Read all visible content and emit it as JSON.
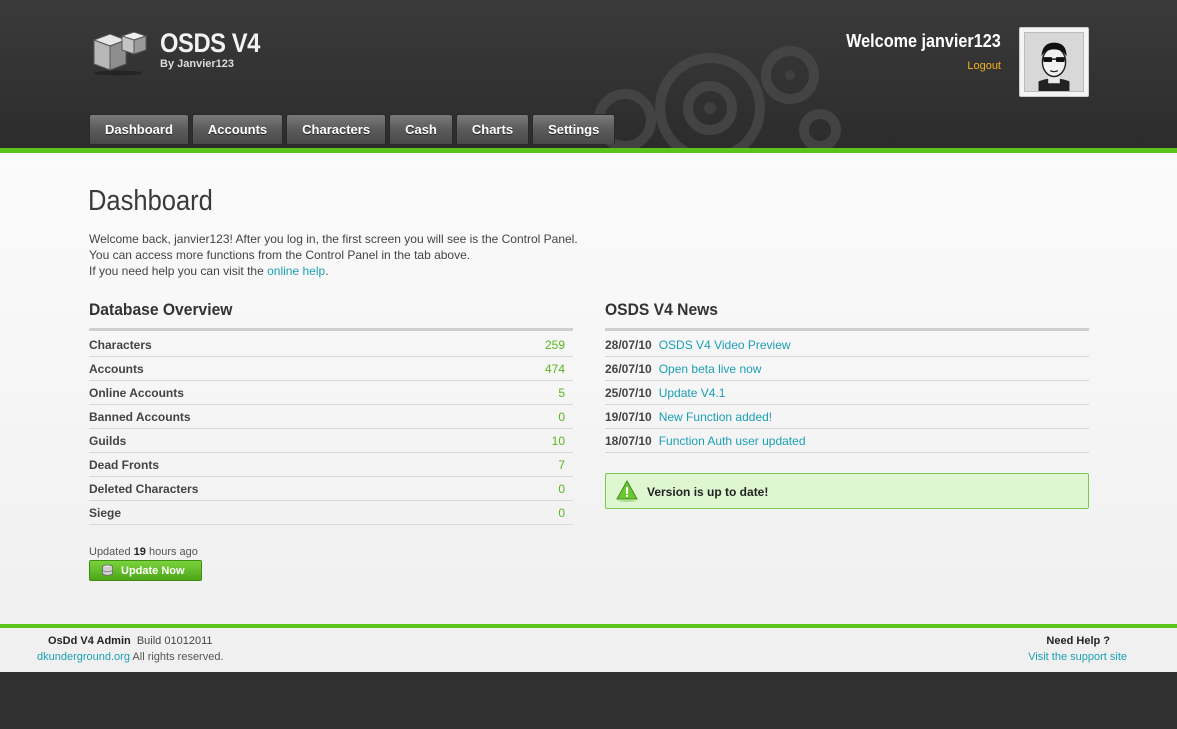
{
  "header": {
    "app_title": "OSDS V4",
    "app_subtitle": "By Janvier123",
    "welcome": "Welcome janvier123",
    "logout": "Logout",
    "nav": [
      {
        "label": "Dashboard"
      },
      {
        "label": "Accounts"
      },
      {
        "label": "Characters"
      },
      {
        "label": "Cash"
      },
      {
        "label": "Charts"
      },
      {
        "label": "Settings"
      }
    ]
  },
  "main": {
    "title": "Dashboard",
    "intro_line1": "Welcome back, janvier123! After you log in, the first screen you will see is the Control Panel.",
    "intro_line2": "You can access more functions from the Control Panel in the tab above.",
    "intro_line3_prefix": "If you need help you can visit the ",
    "intro_link": "online help",
    "intro_line3_suffix": "."
  },
  "overview": {
    "title": "Database Overview",
    "rows": [
      {
        "label": "Characters",
        "value": "259"
      },
      {
        "label": "Accounts",
        "value": "474"
      },
      {
        "label": "Online Accounts",
        "value": "5"
      },
      {
        "label": "Banned Accounts",
        "value": "0"
      },
      {
        "label": "Guilds",
        "value": "10"
      },
      {
        "label": "Dead Fronts",
        "value": "7"
      },
      {
        "label": "Deleted Characters",
        "value": "0"
      },
      {
        "label": "Siege",
        "value": "0"
      }
    ],
    "updated_prefix": "Updated ",
    "updated_hours": "19",
    "updated_suffix": " hours ago",
    "update_button": "Update Now"
  },
  "news": {
    "title": "OSDS V4 News",
    "items": [
      {
        "date": "28/07/10",
        "title": "OSDS V4 Video Preview"
      },
      {
        "date": "26/07/10",
        "title": "Open beta live now"
      },
      {
        "date": "25/07/10",
        "title": "Update V4.1"
      },
      {
        "date": "19/07/10",
        "title": "New Function added!"
      },
      {
        "date": "18/07/10",
        "title": "Function Auth user updated"
      }
    ],
    "version_status": "Version is up to date!"
  },
  "footer": {
    "app_name": "OsDd V4 Admin",
    "build": "Build 01012011",
    "site_link": "dkunderground.org",
    "rights": "All rights reserved.",
    "help_title": "Need Help ?",
    "help_link": "Visit the support site"
  },
  "colors": {
    "accent_green": "#5cc31a",
    "link_blue": "#1a9fb5",
    "logout_orange": "#f4b022",
    "header_dark": "#333333"
  }
}
